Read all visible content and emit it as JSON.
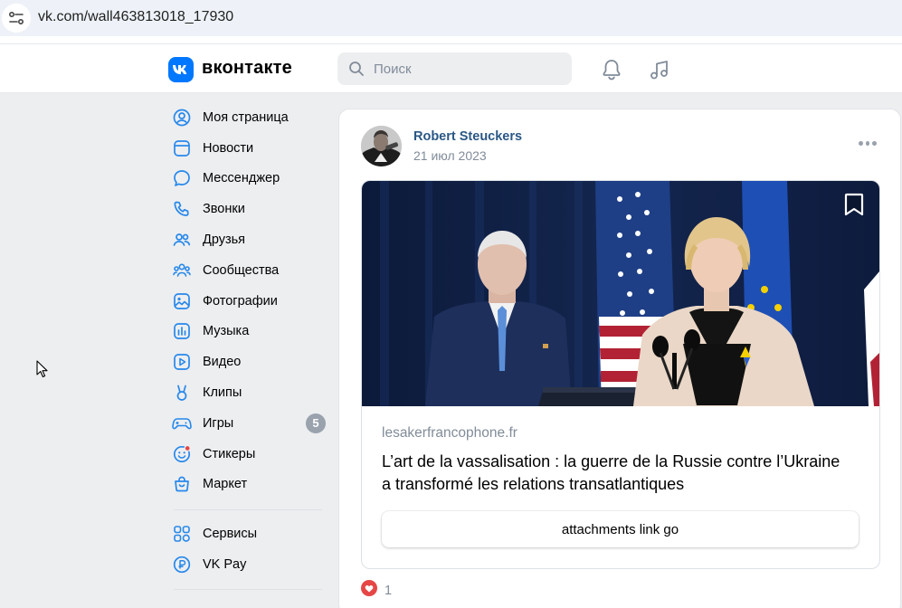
{
  "browser": {
    "url": "vk.com/wall463813018_17930"
  },
  "header": {
    "logo_text": "вконтакте",
    "search_placeholder": "Поиск",
    "accent_color": "#0077ff"
  },
  "sidebar": {
    "items": [
      {
        "label": "Моя страница",
        "icon": "profile-icon"
      },
      {
        "label": "Новости",
        "icon": "news-icon"
      },
      {
        "label": "Мессенджер",
        "icon": "messenger-icon"
      },
      {
        "label": "Звонки",
        "icon": "phone-icon"
      },
      {
        "label": "Друзья",
        "icon": "friends-icon"
      },
      {
        "label": "Сообщества",
        "icon": "communities-icon"
      },
      {
        "label": "Фотографии",
        "icon": "photos-icon"
      },
      {
        "label": "Музыка",
        "icon": "music-icon"
      },
      {
        "label": "Видео",
        "icon": "video-icon"
      },
      {
        "label": "Клипы",
        "icon": "clips-icon"
      },
      {
        "label": "Игры",
        "icon": "games-icon",
        "badge": "5"
      },
      {
        "label": "Стикеры",
        "icon": "stickers-icon"
      },
      {
        "label": "Маркет",
        "icon": "market-icon"
      }
    ],
    "extra_items": [
      {
        "label": "Сервисы",
        "icon": "services-icon"
      },
      {
        "label": "VK Pay",
        "icon": "vkpay-icon"
      }
    ]
  },
  "post": {
    "author": "Robert Steuckers",
    "date": "21 июл 2023",
    "attachment": {
      "domain": "lesakerfrancophone.fr",
      "title": "L’art de la vassalisation : la guerre de la Russie contre l’Ukraine a transformé les relations transatlantiques",
      "button_label": "attachments link go"
    },
    "likes_count": "1"
  }
}
